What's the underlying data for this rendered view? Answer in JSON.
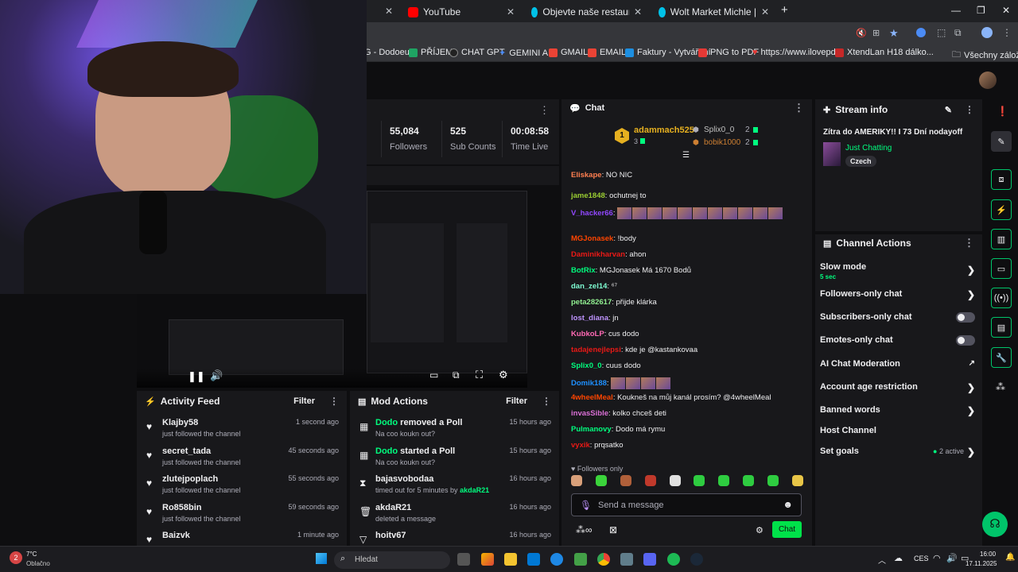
{
  "browser": {
    "tabs": [
      {
        "label": "YouTube",
        "color": "#ff0000"
      },
      {
        "label": "Objevte naše restaurace, super",
        "color": "#00c2e8"
      },
      {
        "label": "Wolt Market Michle | Wolt | Do",
        "color": "#00c2e8"
      }
    ],
    "new_tab": "+",
    "bookmarks": [
      {
        "label": "G - Dodoeu",
        "color": "#444"
      },
      {
        "label": "PŘÍJEM",
        "color": "#1fa463"
      },
      {
        "label": "CHAT GPT",
        "color": "#333"
      },
      {
        "label": "GEMINI AI",
        "color": "#4b8bf5"
      },
      {
        "label": "GMAIL",
        "color": "#ea4335"
      },
      {
        "label": "EMAIL",
        "color": "#ea4335"
      },
      {
        "label": "Faktury - Vytváření",
        "color": "#1d8fe1"
      },
      {
        "label": "PNG to PDF",
        "color": "#e53935"
      },
      {
        "label": "https://www.ilovepd...",
        "color": "#e53935"
      },
      {
        "label": "XtendLan H18 dálko...",
        "color": "#c62828"
      },
      {
        "label": "Všechny záložky",
        "color": "#888"
      }
    ]
  },
  "stats": [
    {
      "value": "55,084",
      "label": "Followers"
    },
    {
      "value": "525",
      "label": "Sub Counts"
    },
    {
      "value": "00:08:58",
      "label": "Time Live"
    }
  ],
  "activity_feed": {
    "title": "Activity Feed",
    "filter": "Filter",
    "items": [
      {
        "name": "Klajby58",
        "sub": "just followed the channel",
        "time": "1 second ago"
      },
      {
        "name": "secret_tada",
        "sub": "just followed the channel",
        "time": "45 seconds ago"
      },
      {
        "name": "zlutejpoplach",
        "sub": "just followed the channel",
        "time": "55 seconds ago"
      },
      {
        "name": "Ro858bin",
        "sub": "just followed the channel",
        "time": "59 seconds ago"
      },
      {
        "name": "Baizvk",
        "sub": "",
        "time": "1 minute ago"
      }
    ]
  },
  "mod_actions": {
    "title": "Mod Actions",
    "filter": "Filter",
    "items": [
      {
        "who": "Dodo",
        "action": " removed a Poll",
        "sub": "Na coo koukn out?",
        "time": "15 hours ago",
        "icon": "▦"
      },
      {
        "who": "Dodo",
        "action": " started a Poll",
        "sub": "Na coo koukn out?",
        "time": "15 hours ago",
        "icon": "▦"
      },
      {
        "who": "bajasvobodaa",
        "action": "",
        "sub": "timed out for 5 minutes by ",
        "sub_by": "akdaR21",
        "time": "16 hours ago",
        "icon": "⧗"
      },
      {
        "who": "akdaR21",
        "action": "",
        "sub": "deleted a message",
        "time": "16 hours ago",
        "icon": "🗑"
      },
      {
        "who": "hoitv67",
        "action": "",
        "sub": "",
        "time": "16 hours ago",
        "icon": "▽"
      }
    ]
  },
  "chat": {
    "title": "Chat",
    "leaderboard": {
      "first": {
        "name": "adammach525",
        "count": "3"
      },
      "second": {
        "name": "Splix0_0",
        "count": "2"
      },
      "third": {
        "name": "bobik1000",
        "count": "2"
      },
      "rank": "1"
    },
    "messages": [
      {
        "user": "Eliskape",
        "color": "#ff7f50",
        "text": "NO NIC"
      },
      {
        "user": "jame1848",
        "color": "#9acd32",
        "text": "ochutnej to"
      },
      {
        "user": "V_hacker66",
        "color": "#9147ff",
        "text": "",
        "emotes": 11
      },
      {
        "user": "MGJonasek",
        "color": "#ff4500",
        "text": "!body"
      },
      {
        "user": "Daminikharvan",
        "color": "#e91916",
        "text": "ahon"
      },
      {
        "user": "BotRix",
        "color": "#00ff7f",
        "text": "MGJonasek Má 1670 Bodů"
      },
      {
        "user": "dan_zel14",
        "color": "#7fffd4",
        "text": "⁶⁷"
      },
      {
        "user": "peta282617",
        "color": "#90ee90",
        "text": "přijde klárka"
      },
      {
        "user": "lost_diana",
        "color": "#bf94ff",
        "text": "jn"
      },
      {
        "user": "KubkoLP",
        "color": "#ff69b4",
        "text": "cus dodo"
      },
      {
        "user": "tadajenejlepsi",
        "color": "#e91916",
        "text": "kde je @kastankovaa"
      },
      {
        "user": "Splix0_0",
        "color": "#00ff7f",
        "text": "cuus dodo"
      },
      {
        "user": "Domik188",
        "color": "#1e90ff",
        "text": "",
        "emotes": 4
      },
      {
        "user": "4wheelMeal",
        "color": "#ff4500",
        "text": "Koukneš na můj kanál prosím? @4wheelMeal"
      },
      {
        "user": "invasSible",
        "color": "#da70d6",
        "text": "kolko chceš deti"
      },
      {
        "user": "Pulmanovy",
        "color": "#00ff7f",
        "text": "Dodo má rymu"
      },
      {
        "user": "vyxik",
        "color": "#e91916",
        "text": "prqsatko"
      }
    ],
    "followers_only": "Followers only",
    "placeholder": "Send a message",
    "send_label": "Chat"
  },
  "stream_info": {
    "title": "Stream info",
    "stream_title": "Zítra do AMERIKY!! I 73 Dní nodayoff",
    "category": "Just Chatting",
    "tag": "Czech"
  },
  "channel_actions": {
    "title": "Channel Actions",
    "slow_mode": {
      "label": "Slow mode",
      "value": "5 sec"
    },
    "items": [
      {
        "label": "Followers-only chat",
        "kind": "chevron"
      },
      {
        "label": "Subscribers-only chat",
        "kind": "toggle"
      },
      {
        "label": "Emotes-only chat",
        "kind": "toggle"
      },
      {
        "label": "AI Chat Moderation",
        "kind": "external"
      },
      {
        "label": "Account age restriction",
        "kind": "chevron"
      },
      {
        "label": "Banned words",
        "kind": "chevron"
      },
      {
        "label": "Host Channel",
        "kind": "none"
      }
    ],
    "set_goals": {
      "label": "Set goals",
      "status": "2 active"
    }
  },
  "taskbar": {
    "weather_temp": "7°C",
    "weather_text": "Oblačno",
    "search": "Hledat",
    "lang": "CES",
    "time": "16:00",
    "date": "17.11.2025",
    "badge": "2"
  },
  "colors": {
    "accent": "#00ff7f",
    "twitch_purple": "#9147ff",
    "panel": "#18181b"
  }
}
